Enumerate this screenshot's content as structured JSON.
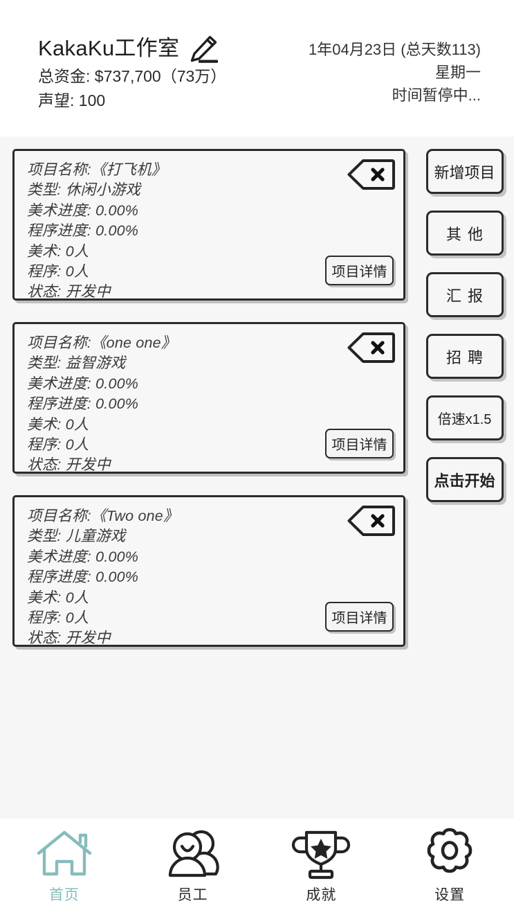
{
  "header": {
    "studio_name": "KakaKu工作室",
    "edit_icon": "pencil-icon",
    "money_line": "总资金: $737,700（73万）",
    "reputation_line": "声望: 100",
    "date_line": "1年04月23日 (总天数113)",
    "weekday_line": "星期一",
    "time_status_line": "时间暂停中..."
  },
  "projects": [
    {
      "name_line": "项目名称:《打飞机》",
      "type_line": "类型: 休闲小游戏",
      "art_progress_line": "美术进度: 0.00%",
      "code_progress_line": "程序进度: 0.00%",
      "art_staff_line": "美术: 0人",
      "code_staff_line": "程序: 0人",
      "status_line": "状态: 开发中",
      "details_label": "项目详情",
      "close_label": "×"
    },
    {
      "name_line": "项目名称:《one one》",
      "type_line": "类型: 益智游戏",
      "art_progress_line": "美术进度: 0.00%",
      "code_progress_line": "程序进度: 0.00%",
      "art_staff_line": "美术: 0人",
      "code_staff_line": "程序: 0人",
      "status_line": "状态: 开发中",
      "details_label": "项目详情",
      "close_label": "×"
    },
    {
      "name_line": "项目名称:《Two one》",
      "type_line": "类型: 儿童游戏",
      "art_progress_line": "美术进度: 0.00%",
      "code_progress_line": "程序进度: 0.00%",
      "art_staff_line": "美术: 0人",
      "code_staff_line": "程序: 0人",
      "status_line": "状态: 开发中",
      "details_label": "项目详情",
      "close_label": "×"
    }
  ],
  "rail": {
    "new_project": "新增项目",
    "other": "其他",
    "report": "汇报",
    "recruit": "招聘",
    "speed": "倍速x1.5",
    "start": "点击开始"
  },
  "bottom_nav": {
    "items": [
      {
        "label": "首页",
        "icon": "home-icon",
        "active": true
      },
      {
        "label": "员工",
        "icon": "people-icon",
        "active": false
      },
      {
        "label": "成就",
        "icon": "trophy-icon",
        "active": false
      },
      {
        "label": "设置",
        "icon": "gear-icon",
        "active": false
      }
    ]
  },
  "colors": {
    "accent_teal": "#86bcbc",
    "ink": "#2b2b2b",
    "page_bg": "#f6f6f6",
    "header_bg": "#ffffff"
  }
}
